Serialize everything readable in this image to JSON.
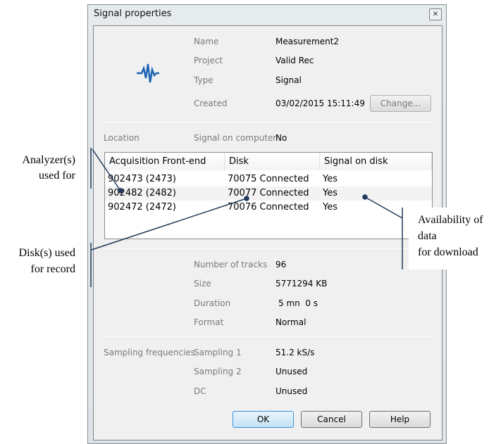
{
  "dialog": {
    "title": "Signal properties",
    "close_icon": "close-icon",
    "signal_icon": "waveform-icon",
    "icon_color": "#1e64b4"
  },
  "info": {
    "name_label": "Name",
    "name": "Measurement2",
    "project_label": "Project",
    "project": "Valid Rec",
    "type_label": "Type",
    "type": "Signal",
    "created_label": "Created",
    "created": "03/02/2015 15:11:49",
    "change_button": "Change..."
  },
  "location": {
    "label": "Location",
    "signal_on_computer_label": "Signal on computer",
    "signal_on_computer": "No"
  },
  "table": {
    "columns": [
      "Acquisition Front-end",
      "Disk",
      "Signal on disk"
    ],
    "rows": [
      [
        "902473 (2473)",
        "70075 Connected",
        "Yes"
      ],
      [
        "902482 (2482)",
        "70077 Connected",
        "Yes"
      ],
      [
        "902472 (2472)",
        "70076 Connected",
        "Yes"
      ]
    ]
  },
  "details": {
    "tracks_label": "Number of tracks",
    "tracks": "96",
    "size_label": "Size",
    "size": "5771294 KB",
    "duration_label": "Duration",
    "duration": "5 mn  0 s",
    "format_label": "Format",
    "format": "Normal"
  },
  "sampling": {
    "label": "Sampling frequencies",
    "s1_label": "Sampling 1",
    "s1": "51.2 kS/s",
    "s2_label": "Sampling 2",
    "s2": "Unused",
    "dc_label": "DC",
    "dc": "Unused"
  },
  "buttons": {
    "ok": "OK",
    "cancel": "Cancel",
    "help": "Help"
  },
  "annotations": {
    "analyzer": [
      "Analyzer(s)",
      "used for"
    ],
    "disk": [
      "Disk(s) used",
      "for record"
    ],
    "availability": [
      "Availability of",
      "data",
      "for download"
    ],
    "line_color": "#1f3a5a"
  }
}
